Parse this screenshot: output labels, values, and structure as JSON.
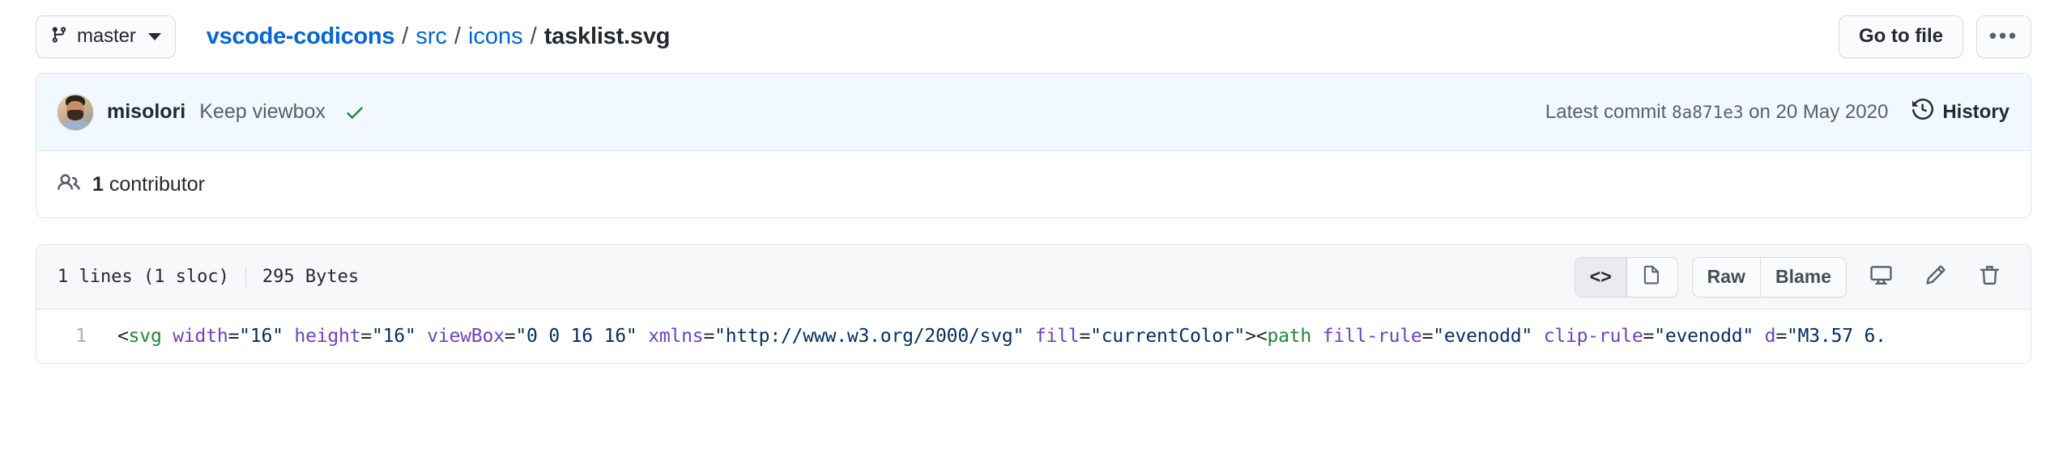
{
  "topbar": {
    "branch": {
      "icon": "git-branch-icon",
      "name": "master"
    },
    "breadcrumb": {
      "repo": "vscode-codicons",
      "separator": "/",
      "dirs": [
        "src",
        "icons"
      ],
      "file": "tasklist.svg"
    },
    "actions": {
      "go_to_file": "Go to file",
      "kebab": "•••"
    }
  },
  "commit": {
    "author": "misolori",
    "message": "Keep viewbox",
    "verified_icon": "check-icon",
    "latest_commit_prefix": "Latest commit",
    "sha": "8a871e3",
    "date_prefix": "on",
    "date": "20 May 2020",
    "history_label": "History",
    "history_icon": "history-clock-icon"
  },
  "contributors": {
    "icon": "people-icon",
    "count": "1",
    "label": "contributor"
  },
  "blob": {
    "lines_info": "1 lines (1 sloc)",
    "size": "295 Bytes",
    "actions": {
      "code_view": "<>",
      "preview_icon": "file-preview-icon",
      "raw": "Raw",
      "blame": "Blame",
      "desktop_icon": "open-in-desktop-icon",
      "edit_icon": "pencil-edit-icon",
      "delete_icon": "trash-delete-icon"
    },
    "line_number": "1",
    "code_tokens": [
      {
        "t": "punct",
        "v": "<"
      },
      {
        "t": "tag",
        "v": "svg"
      },
      {
        "t": "punct",
        "v": " "
      },
      {
        "t": "attr",
        "v": "width"
      },
      {
        "t": "punct",
        "v": "="
      },
      {
        "t": "str",
        "v": "\"16\""
      },
      {
        "t": "punct",
        "v": " "
      },
      {
        "t": "attr",
        "v": "height"
      },
      {
        "t": "punct",
        "v": "="
      },
      {
        "t": "str",
        "v": "\"16\""
      },
      {
        "t": "punct",
        "v": " "
      },
      {
        "t": "attr",
        "v": "viewBox"
      },
      {
        "t": "punct",
        "v": "="
      },
      {
        "t": "str",
        "v": "\"0 0 16 16\""
      },
      {
        "t": "punct",
        "v": " "
      },
      {
        "t": "attr",
        "v": "xmlns"
      },
      {
        "t": "punct",
        "v": "="
      },
      {
        "t": "str",
        "v": "\"http://www.w3.org/2000/svg\""
      },
      {
        "t": "punct",
        "v": " "
      },
      {
        "t": "attr",
        "v": "fill"
      },
      {
        "t": "punct",
        "v": "="
      },
      {
        "t": "str",
        "v": "\"currentColor\""
      },
      {
        "t": "punct",
        "v": "><"
      },
      {
        "t": "tag",
        "v": "path"
      },
      {
        "t": "punct",
        "v": " "
      },
      {
        "t": "attr",
        "v": "fill-rule"
      },
      {
        "t": "punct",
        "v": "="
      },
      {
        "t": "str",
        "v": "\"evenodd\""
      },
      {
        "t": "punct",
        "v": " "
      },
      {
        "t": "attr",
        "v": "clip-rule"
      },
      {
        "t": "punct",
        "v": "="
      },
      {
        "t": "str",
        "v": "\"evenodd\""
      },
      {
        "t": "punct",
        "v": " "
      },
      {
        "t": "attr",
        "v": "d"
      },
      {
        "t": "punct",
        "v": "="
      },
      {
        "t": "str",
        "v": "\"M3.57 6."
      }
    ]
  },
  "colors": {
    "link": "#0366d6",
    "text": "#24292e",
    "muted": "#586069",
    "border": "#e1e4e8",
    "commit_bg": "#f1f8ff",
    "commit_border": "#c8e1ff",
    "header_bg": "#f6f8fa",
    "verified_green": "#22863a",
    "syntax_tag": "#22863a",
    "syntax_attr": "#6f42c1",
    "syntax_string": "#032f62"
  }
}
